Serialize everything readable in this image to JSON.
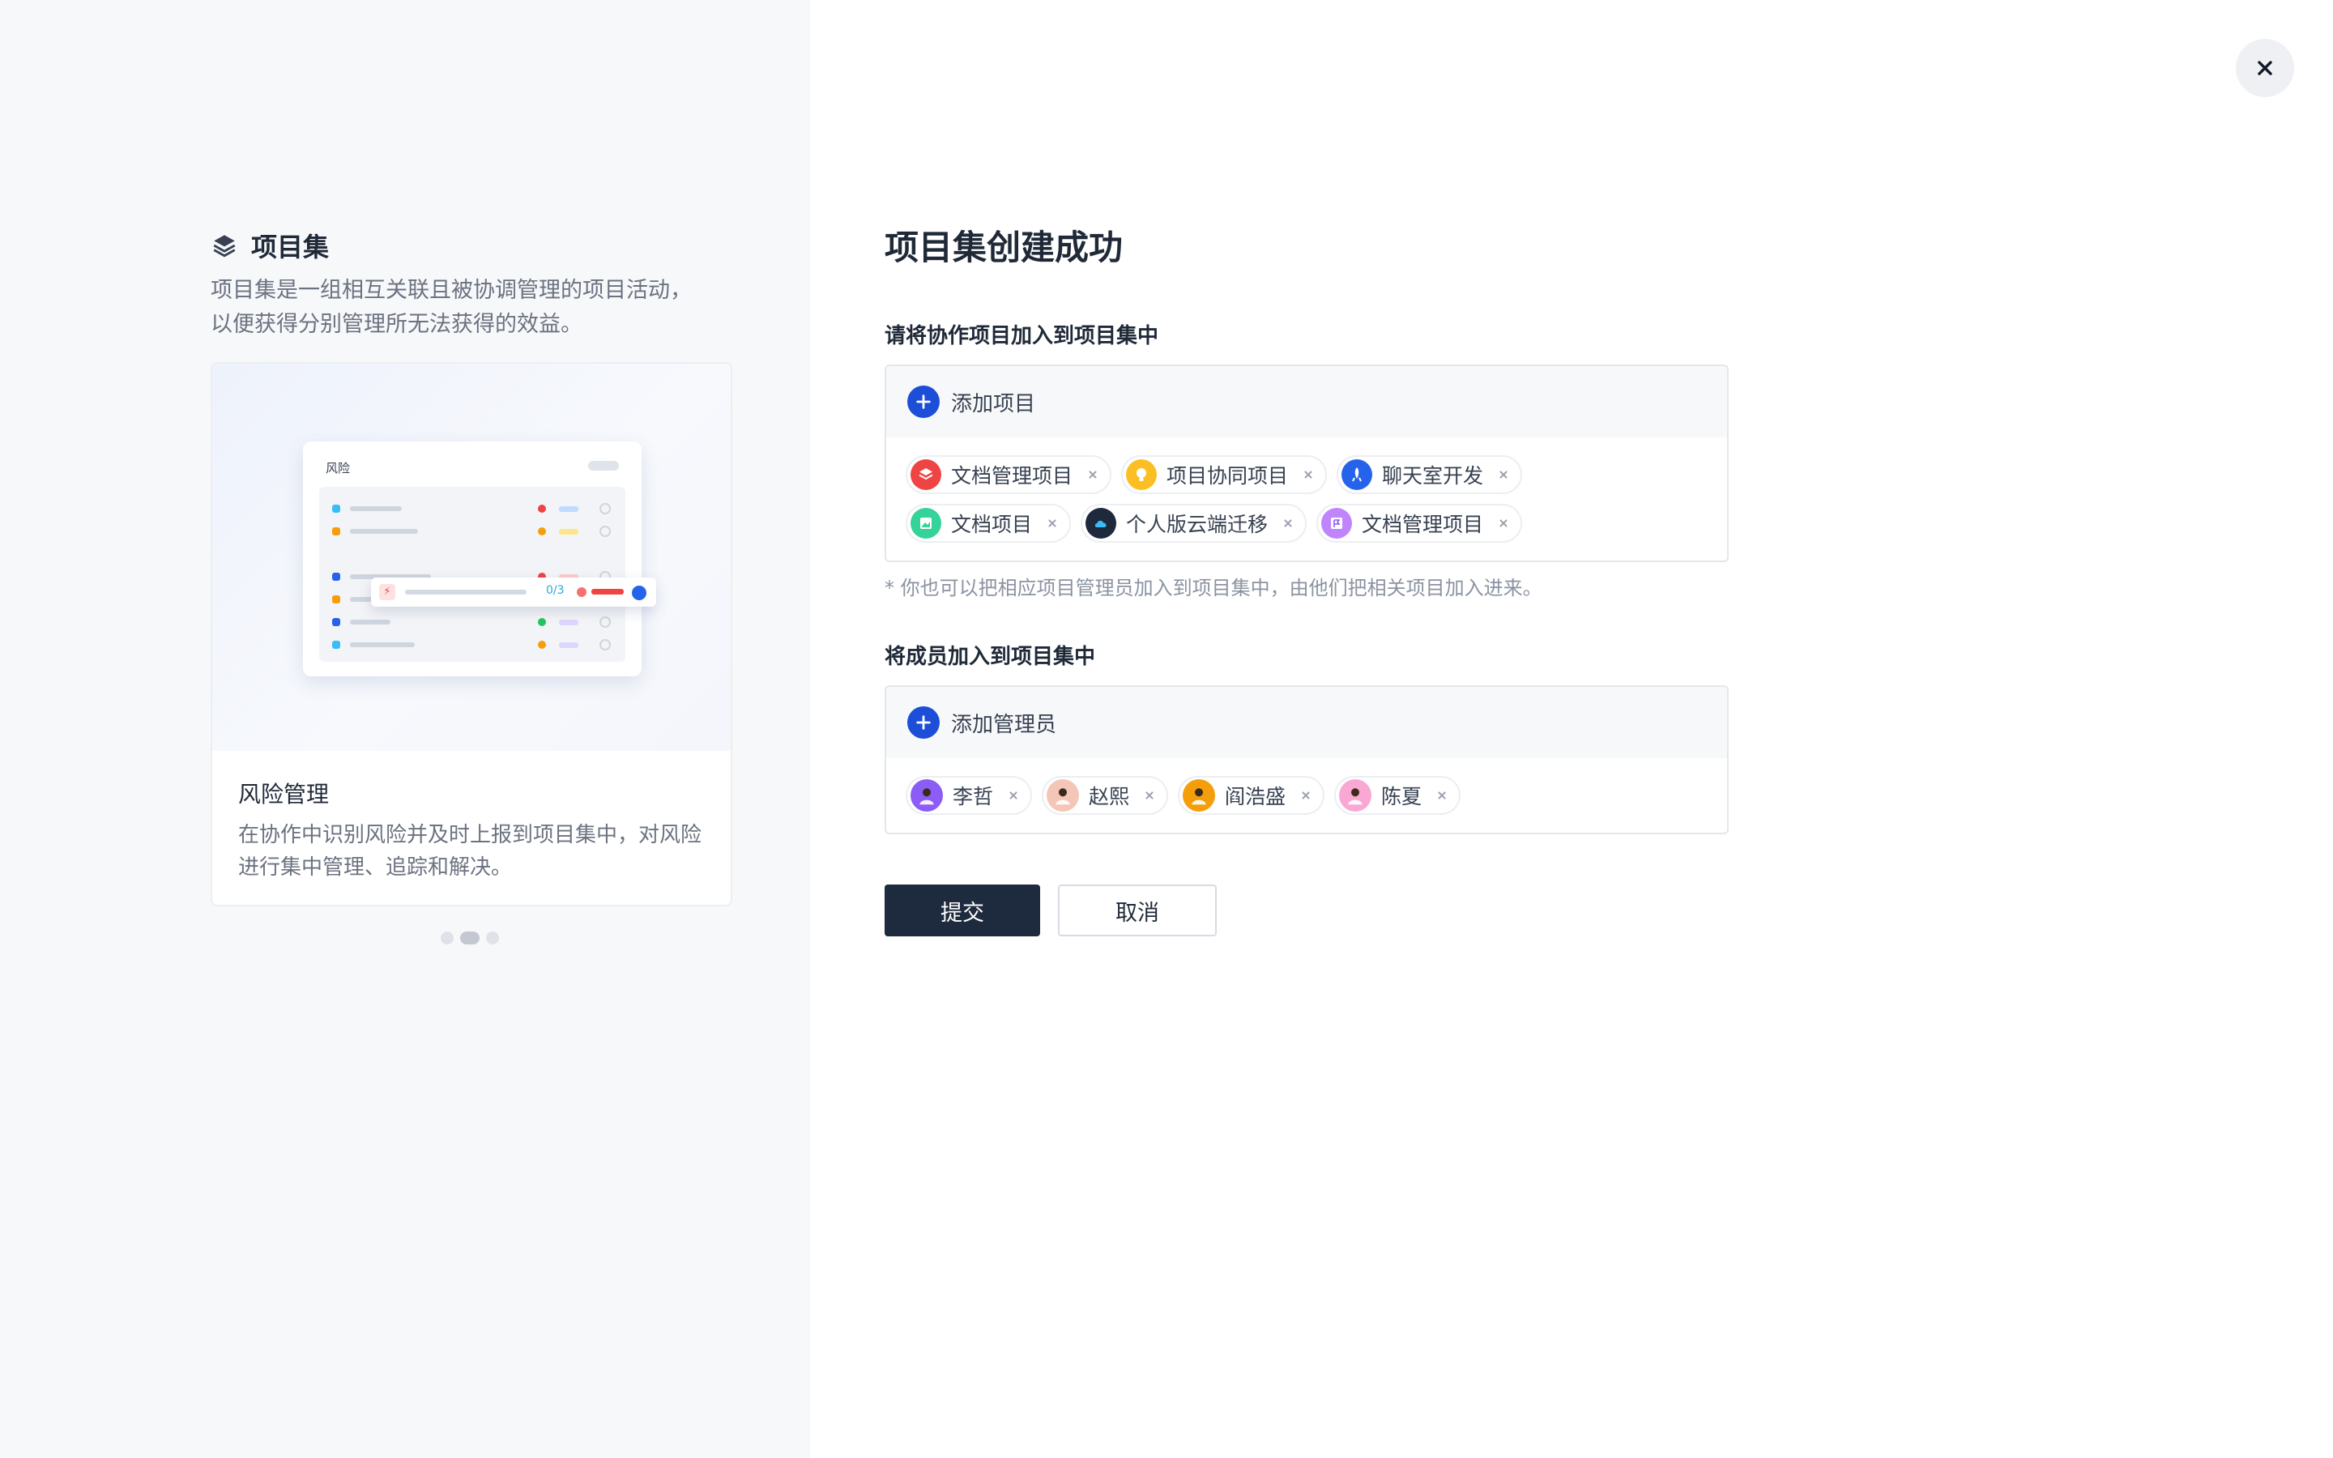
{
  "intro": {
    "title": "项目集",
    "desc_line1": "项目集是一组相互关联且被协调管理的项目活动，",
    "desc_line2": "以便获得分别管理所无法获得的效益。",
    "icon": "layers-icon"
  },
  "feature": {
    "mock_title": "风险",
    "mock_count": "0/3",
    "name": "风险管理",
    "desc_line1": "在协作中识别风险并及时上报到项目集中，对风险",
    "desc_line2": "进行集中管理、追踪和解决。"
  },
  "carousel": {
    "count": 3,
    "active_index": 1
  },
  "main": {
    "title": "项目集创建成功",
    "projects_label": "请将协作项目加入到项目集中",
    "add_project_label": "添加项目",
    "projects": [
      {
        "label": "文档管理项目",
        "icon": "stack-project-icon",
        "color": "#ef4444"
      },
      {
        "label": "项目协同项目",
        "icon": "lightbulb-project-icon",
        "color": "#fbbf24"
      },
      {
        "label": "聊天室开发",
        "icon": "rocket-project-icon",
        "color": "#2563eb"
      },
      {
        "label": "文档项目",
        "icon": "image-project-icon",
        "color": "#34d399"
      },
      {
        "label": "个人版云端迁移",
        "icon": "cloud-project-icon",
        "color": "#1e293b"
      },
      {
        "label": "文档管理项目",
        "icon": "flag-project-icon",
        "color": "#c084fc"
      }
    ],
    "hint": "* 你也可以把相应项目管理员加入到项目集中，由他们把相关项目加入进来。",
    "members_label": "将成员加入到项目集中",
    "add_member_label": "添加管理员",
    "members": [
      {
        "label": "李哲",
        "icon": "avatar-icon",
        "color": "#8b5cf6"
      },
      {
        "label": "赵熙",
        "icon": "avatar-icon",
        "color": "#f3c6b8"
      },
      {
        "label": "阎浩盛",
        "icon": "avatar-icon",
        "color": "#f59e0b"
      },
      {
        "label": "陈夏",
        "icon": "avatar-icon",
        "color": "#f9a8d4"
      }
    ],
    "submit_label": "提交",
    "cancel_label": "取消"
  },
  "colors": {
    "primary_button": "#1e2a3d",
    "accent_blue": "#1d4ed8",
    "left_panel_bg": "#f7f8fa"
  }
}
